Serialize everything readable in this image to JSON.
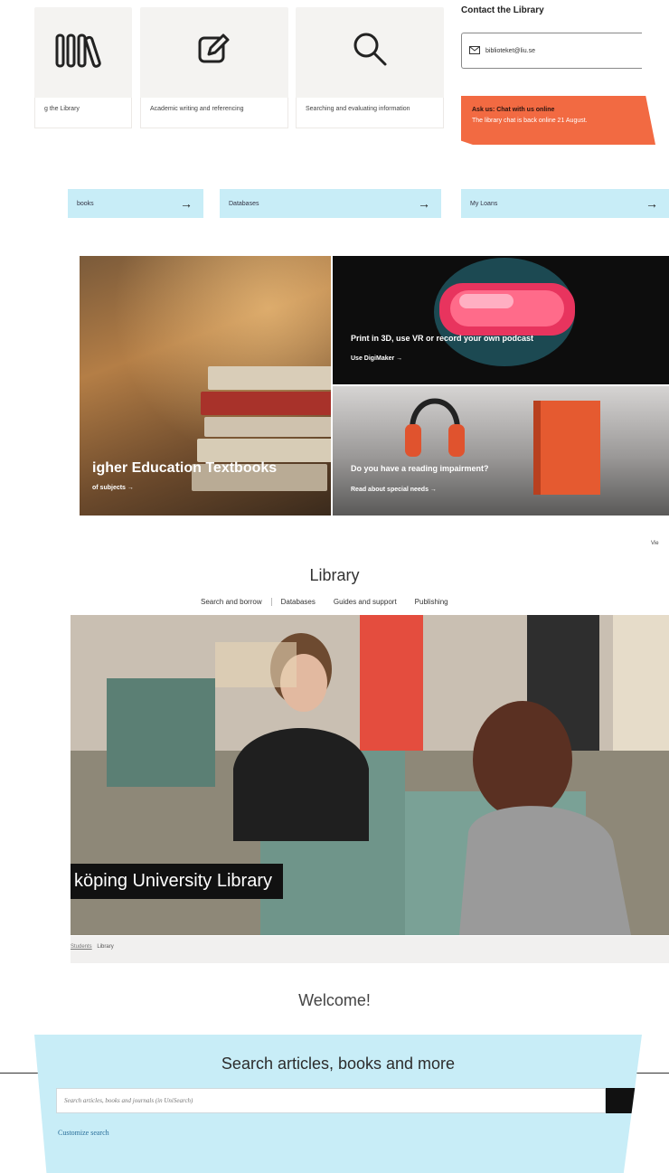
{
  "quick_links": [
    {
      "label": "g the Library",
      "icon": "books-icon"
    },
    {
      "label": "Academic writing and referencing",
      "icon": "pencil-square-icon"
    },
    {
      "label": "Searching and evaluating information",
      "icon": "search-icon"
    }
  ],
  "contact": {
    "title": "Contact the Library",
    "email": "biblioteket@liu.se"
  },
  "ask_us": {
    "title": "Ask us: Chat with us online",
    "subtitle": "The library chat is back online 21 August."
  },
  "shortcut_pills": [
    {
      "label": "books",
      "arrow": "→"
    },
    {
      "label": "Databases",
      "arrow": "→"
    },
    {
      "label": "My Loans",
      "arrow": "→"
    }
  ],
  "promos": {
    "textbooks": {
      "title": "igher Education Textbooks",
      "link": "of subjects →"
    },
    "digimaker": {
      "title": "Print in 3D, use VR or record your own podcast",
      "link": "Use DigiMaker →"
    },
    "special_needs": {
      "title": "Do you have a reading impairment?",
      "link": "Read about special needs →"
    }
  },
  "view_all": "Vie",
  "library": {
    "title": "Library",
    "nav": [
      "Search and borrow",
      "Databases",
      "Guides and support",
      "Publishing"
    ],
    "hero_caption": "köping University Library",
    "breadcrumb": [
      "Students",
      "Library"
    ],
    "welcome": "Welcome!"
  },
  "search": {
    "title": "Search articles, books and more",
    "placeholder": "Search articles, books and journals (in UniSearch)",
    "customize": "Customize search"
  },
  "colors": {
    "accent_blue": "#c8edf7",
    "accent_orange": "#f26a42"
  }
}
